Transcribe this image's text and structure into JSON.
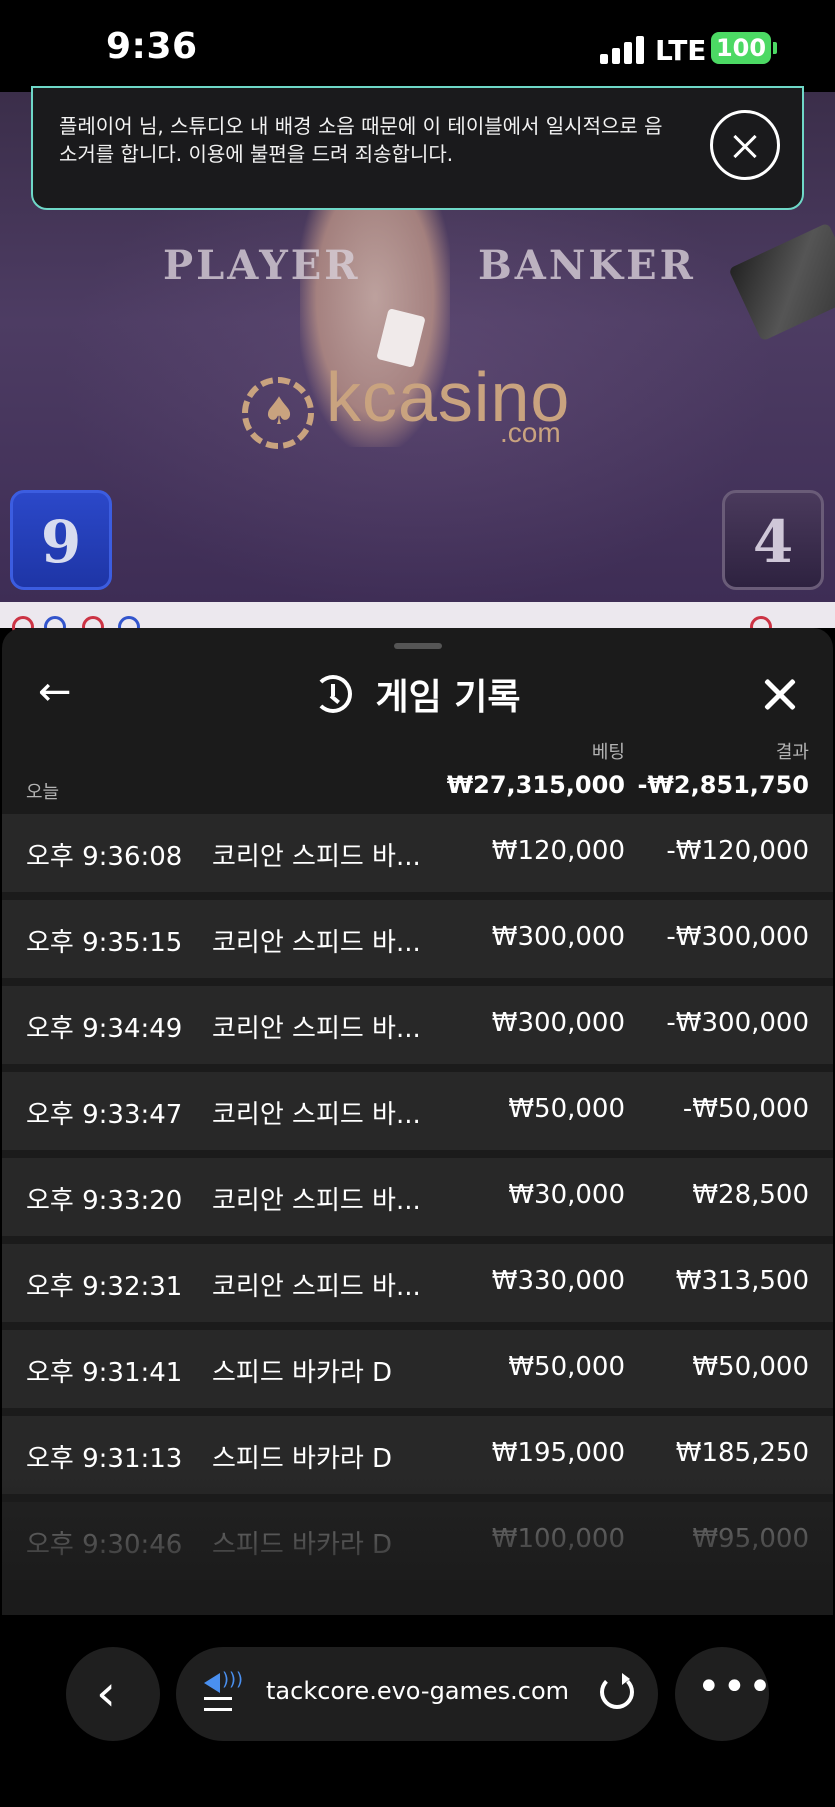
{
  "status_bar": {
    "time": "9:36",
    "network": "LTE",
    "battery": "100"
  },
  "notice": {
    "text": "플레이어 님, 스튜디오 내 배경 소음 때문에 이 테이블에서 일시적으로 음소거를 합니다. 이용에 불편을 드려 죄송합니다."
  },
  "video": {
    "player_label": "PLAYER",
    "banker_label": "BANKER",
    "logo_text": "kcasino",
    "logo_sub": ".com",
    "player_score": "9",
    "banker_score": "4"
  },
  "history": {
    "title": "게임 기록",
    "headers": {
      "bet": "베팅",
      "result": "결과"
    },
    "today_label": "오늘",
    "total_bet": "₩27,315,000",
    "total_result": "-₩2,851,750",
    "rows": [
      {
        "time": "오후 9:36:08",
        "game": "코리안 스피드 바...",
        "bet": "₩120,000",
        "result": "-₩120,000"
      },
      {
        "time": "오후 9:35:15",
        "game": "코리안 스피드 바...",
        "bet": "₩300,000",
        "result": "-₩300,000"
      },
      {
        "time": "오후 9:34:49",
        "game": "코리안 스피드 바...",
        "bet": "₩300,000",
        "result": "-₩300,000"
      },
      {
        "time": "오후 9:33:47",
        "game": "코리안 스피드 바...",
        "bet": "₩50,000",
        "result": "-₩50,000"
      },
      {
        "time": "오후 9:33:20",
        "game": "코리안 스피드 바...",
        "bet": "₩30,000",
        "result": "₩28,500"
      },
      {
        "time": "오후 9:32:31",
        "game": "코리안 스피드 바...",
        "bet": "₩330,000",
        "result": "₩313,500"
      },
      {
        "time": "오후 9:31:41",
        "game": "스피드 바카라 D",
        "bet": "₩50,000",
        "result": "₩50,000"
      },
      {
        "time": "오후 9:31:13",
        "game": "스피드 바카라 D",
        "bet": "₩195,000",
        "result": "₩185,250"
      },
      {
        "time": "오후 9:30:46",
        "game": "스피드 바카라 D",
        "bet": "₩100,000",
        "result": "₩95,000"
      }
    ]
  },
  "browser": {
    "url": "tackcore.evo-games.com",
    "icons": [
      "chevron-left-icon",
      "speaker-icon",
      "reload-icon",
      "more-icon"
    ]
  }
}
